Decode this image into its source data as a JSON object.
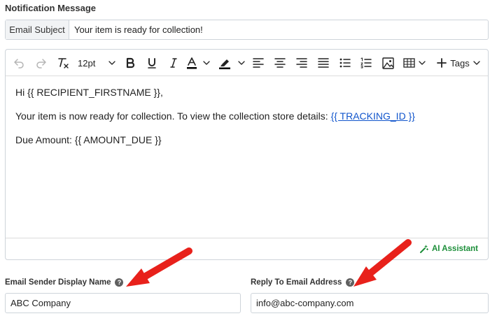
{
  "section_title": "Notification Message",
  "subject": {
    "addon_label": "Email Subject",
    "value": "Your item is ready for collection!"
  },
  "toolbar": {
    "font_size": "12pt",
    "tags_label": "Tags"
  },
  "body": {
    "greeting": "Hi {{ RECIPIENT_FIRSTNAME }},",
    "line2_text": "Your item is now ready for collection. To view the collection store details: ",
    "line2_link": "{{ TRACKING_ID }}",
    "line3": "Due Amount: {{ AMOUNT_DUE }}"
  },
  "ai_assistant_label": "AI Assistant",
  "sender": {
    "label": "Email Sender Display Name",
    "value": "ABC Company"
  },
  "reply_to": {
    "label": "Reply To Email Address",
    "value": "info@abc-company.com"
  },
  "help_glyph": "?",
  "colors": {
    "accent_green": "#1d8f3a",
    "link_blue": "#1155cc",
    "annotation_red": "#e8211b"
  }
}
